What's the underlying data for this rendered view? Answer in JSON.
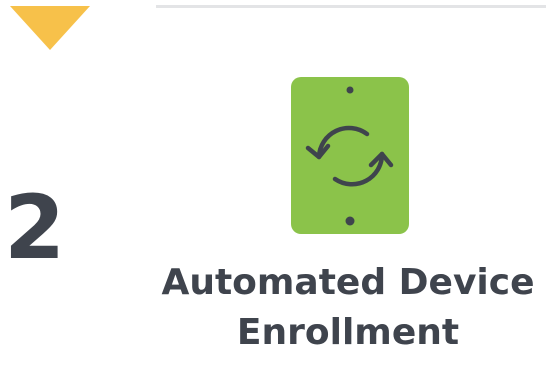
{
  "step": {
    "number": "2",
    "marker_color": "#f7c14a",
    "marker_icon": "triangle-down-icon"
  },
  "feature": {
    "icon": "tablet-sync-icon",
    "icon_color": "#8bc34a",
    "title_line1": "Automated Device",
    "title_line2": "Enrollment"
  },
  "colors": {
    "text": "#3f444d",
    "divider": "#e3e4e6"
  }
}
